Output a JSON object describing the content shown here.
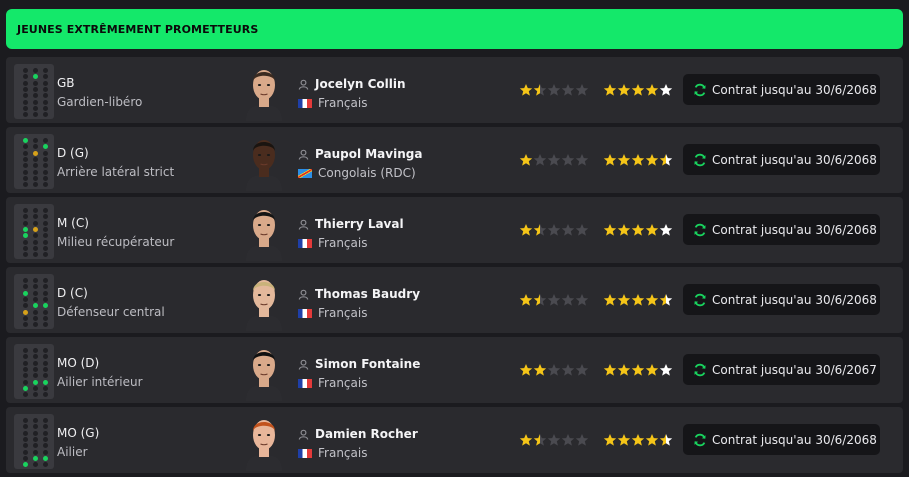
{
  "header": {
    "title": "JEUNES EXTRÊMEMENT PROMETTEURS"
  },
  "colors": {
    "accent": "#14e86a",
    "star": "#f5c518",
    "star_empty": "#4a4a50",
    "position_on": "#19d35e",
    "position_partial": "#d6a11a"
  },
  "icons": {
    "person": "person-icon",
    "contract": "refresh-icon",
    "star": "star-icon"
  },
  "players": [
    {
      "position": "GB",
      "role": "Gardien-libéro",
      "name": "Jocelyn Collin",
      "nationality": "Français",
      "flag": "fr",
      "current_ability": 1.5,
      "potential_ability": 5,
      "contract": "Contrat jusqu'au 30/6/2068",
      "pitch": [
        [
          4,
          "on"
        ]
      ],
      "face": {
        "skin": "#d9a98a",
        "hair": "#3a2a20",
        "shirt": "#2c2c30"
      }
    },
    {
      "position": "D (G)",
      "role": "Arrière latéral strict",
      "name": "Paupol Mavinga",
      "nationality": "Congolais (RDC)",
      "flag": "cd",
      "current_ability": 1,
      "potential_ability": 4.5,
      "contract": "Contrat jusqu'au 30/6/2068",
      "pitch": [
        [
          0,
          "on"
        ],
        [
          5,
          "on"
        ],
        [
          7,
          "mid"
        ]
      ],
      "face": {
        "skin": "#4a2c1e",
        "hair": "#1a1410",
        "shirt": "#2c2c30"
      }
    },
    {
      "position": "M (C)",
      "role": "Milieu récupérateur",
      "name": "Thierry Laval",
      "nationality": "Français",
      "flag": "fr",
      "current_ability": 1.5,
      "potential_ability": 5,
      "contract": "Contrat jusqu'au 30/6/2068",
      "pitch": [
        [
          9,
          "on"
        ],
        [
          10,
          "mid"
        ],
        [
          12,
          "on"
        ]
      ],
      "face": {
        "skin": "#d9a98a",
        "hair": "#141414",
        "shirt": "#2c2c30"
      }
    },
    {
      "position": "D (C)",
      "role": "Défenseur central",
      "name": "Thomas Baudry",
      "nationality": "Français",
      "flag": "fr",
      "current_ability": 1.5,
      "potential_ability": 4.5,
      "contract": "Contrat jusqu'au 30/6/2068",
      "pitch": [
        [
          6,
          "on"
        ],
        [
          13,
          "on"
        ],
        [
          14,
          "on"
        ],
        [
          15,
          "mid"
        ]
      ],
      "face": {
        "skin": "#e3b89b",
        "hair": "#c9b27a",
        "shirt": "#2c2c30"
      }
    },
    {
      "position": "MO (D)",
      "role": "Ailier intérieur",
      "name": "Simon Fontaine",
      "nationality": "Français",
      "flag": "fr",
      "current_ability": 2,
      "potential_ability": 5,
      "contract": "Contrat jusqu'au 30/6/2067",
      "pitch": [
        [
          16,
          "on"
        ],
        [
          17,
          "on"
        ],
        [
          18,
          "on"
        ]
      ],
      "face": {
        "skin": "#d9a98a",
        "hair": "#101010",
        "shirt": "#2c2c30"
      }
    },
    {
      "position": "MO (G)",
      "role": "Ailier",
      "name": "Damien Rocher",
      "nationality": "Français",
      "flag": "fr",
      "current_ability": 1.5,
      "potential_ability": 4.5,
      "contract": "Contrat jusqu'au 30/6/2068",
      "pitch": [
        [
          19,
          "on"
        ],
        [
          20,
          "on"
        ],
        [
          21,
          "on"
        ]
      ],
      "face": {
        "skin": "#e8b69a",
        "hair": "#c2521c",
        "shirt": "#2c2c30"
      }
    }
  ]
}
